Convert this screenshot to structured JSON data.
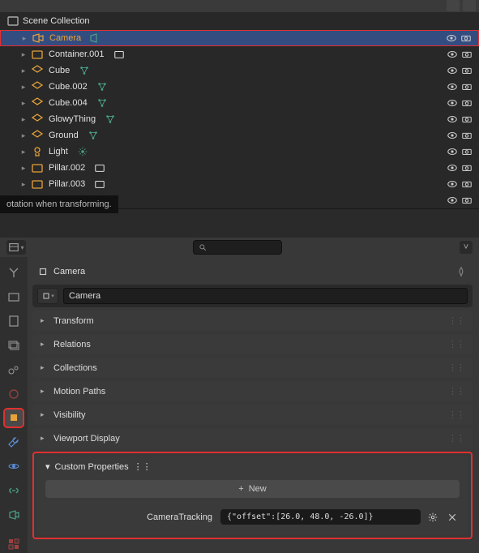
{
  "outliner": {
    "root": "Scene Collection",
    "items": [
      {
        "label": "Camera",
        "type": "camera",
        "selected": true
      },
      {
        "label": "Container.001",
        "type": "collection"
      },
      {
        "label": "Cube",
        "type": "mesh"
      },
      {
        "label": "Cube.002",
        "type": "mesh"
      },
      {
        "label": "Cube.004",
        "type": "mesh"
      },
      {
        "label": "GlowyThing",
        "type": "mesh"
      },
      {
        "label": "Ground",
        "type": "mesh"
      },
      {
        "label": "Light",
        "type": "light"
      },
      {
        "label": "Pillar.002",
        "type": "collection"
      },
      {
        "label": "Pillar.003",
        "type": "collection"
      }
    ]
  },
  "tooltip": "otation when transforming.",
  "properties": {
    "breadcrumb": "Camera",
    "datablock_name": "Camera",
    "search_placeholder": "",
    "panels": [
      {
        "title": "Transform",
        "open": false
      },
      {
        "title": "Relations",
        "open": false
      },
      {
        "title": "Collections",
        "open": false
      },
      {
        "title": "Motion Paths",
        "open": false
      },
      {
        "title": "Visibility",
        "open": false
      },
      {
        "title": "Viewport Display",
        "open": false
      }
    ],
    "custom_properties": {
      "title": "Custom Properties",
      "new_label": "New",
      "prop": {
        "name": "CameraTracking",
        "value": "{\"offset\":[26.0, 48.0, -26.0]}"
      }
    }
  }
}
